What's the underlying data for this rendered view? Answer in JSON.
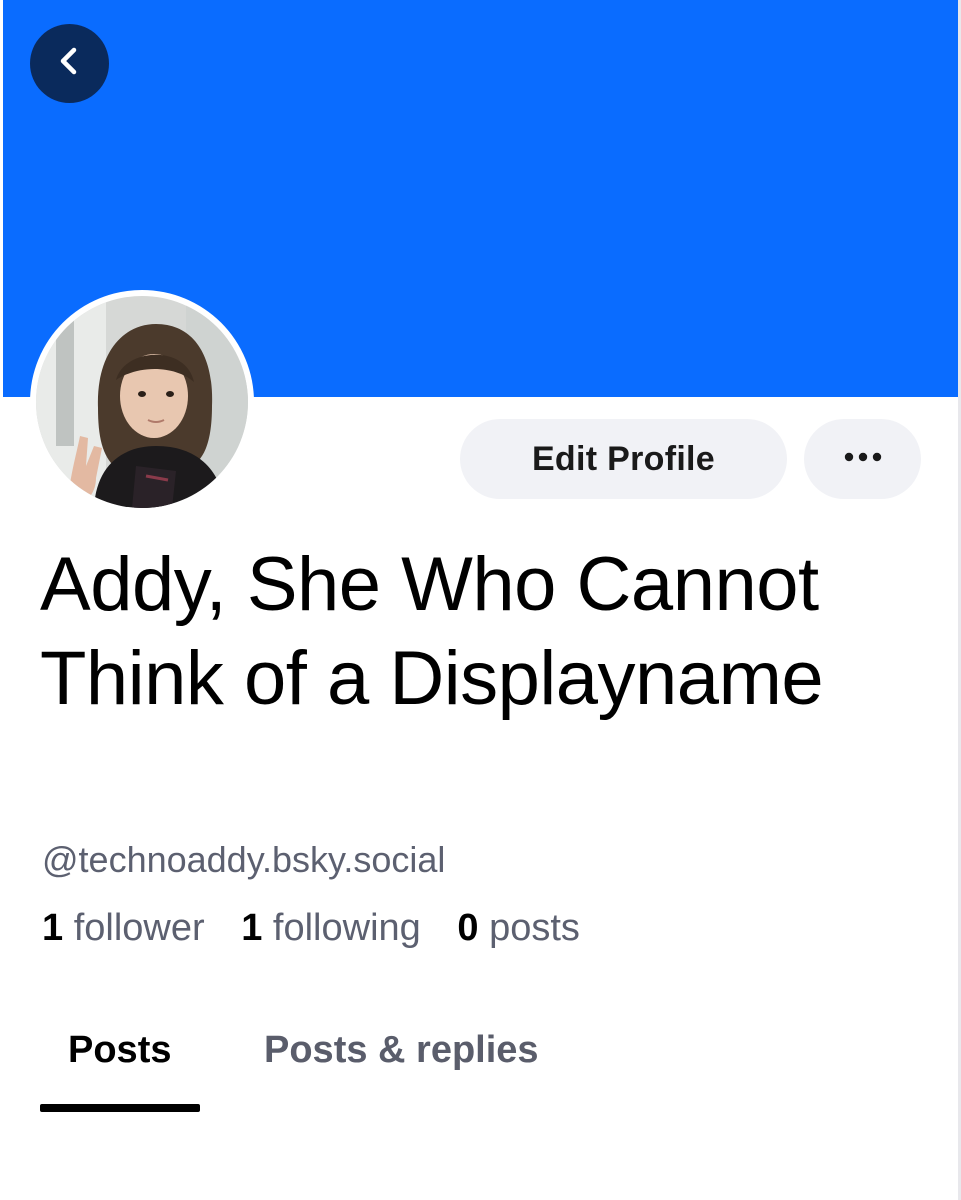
{
  "colors": {
    "banner": "#0a6cff",
    "back_button_bg": "#0a2a5c",
    "pill_bg": "#f1f2f6",
    "secondary_text": "#5c6070"
  },
  "header": {
    "back_icon": "chevron-left-icon"
  },
  "profile": {
    "avatar": "avatar-photo",
    "display_name": "Addy, She Who Cannot Think of a Displayname",
    "handle": "@technoaddy.bsky.social",
    "stats": {
      "followers_count": "1",
      "followers_label": "follower",
      "following_count": "1",
      "following_label": "following",
      "posts_count": "0",
      "posts_label": "posts"
    }
  },
  "actions": {
    "edit_label": "Edit Profile",
    "more_icon": "ellipsis-icon"
  },
  "tabs": [
    {
      "label": "Posts",
      "active": true
    },
    {
      "label": "Posts & replies",
      "active": false
    }
  ]
}
